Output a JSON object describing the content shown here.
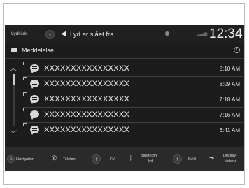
{
  "status_bar": {
    "source_label": "Lydkilde",
    "audio_status": "Lyd er slået fra",
    "clock": "12:34"
  },
  "header": {
    "title": "Meddelelse"
  },
  "messages": [
    {
      "text": "XXXXXXXXXXXXXXXX",
      "time": "8:10 AM"
    },
    {
      "text": "XXXXXXXXXXXXXXXX",
      "time": "8:09 AM"
    },
    {
      "text": "XXXXXXXXXXXXXXXX",
      "time": "7:18 AM"
    },
    {
      "text": "XXXXXXXXXXXXXXXX",
      "time": "7:16 AM"
    },
    {
      "text": "XXXXXXXXXXXXXXXX",
      "time": "6:41 AM"
    }
  ],
  "bottom_nav": {
    "navigation": "Navigation",
    "phone": "Telefon",
    "fm": "FM",
    "bluetooth_line1": "Bluetooth",
    "bluetooth_line2": "lyd",
    "dab": "DAB",
    "display_line1": "Display-",
    "display_line2": "tilstand"
  }
}
